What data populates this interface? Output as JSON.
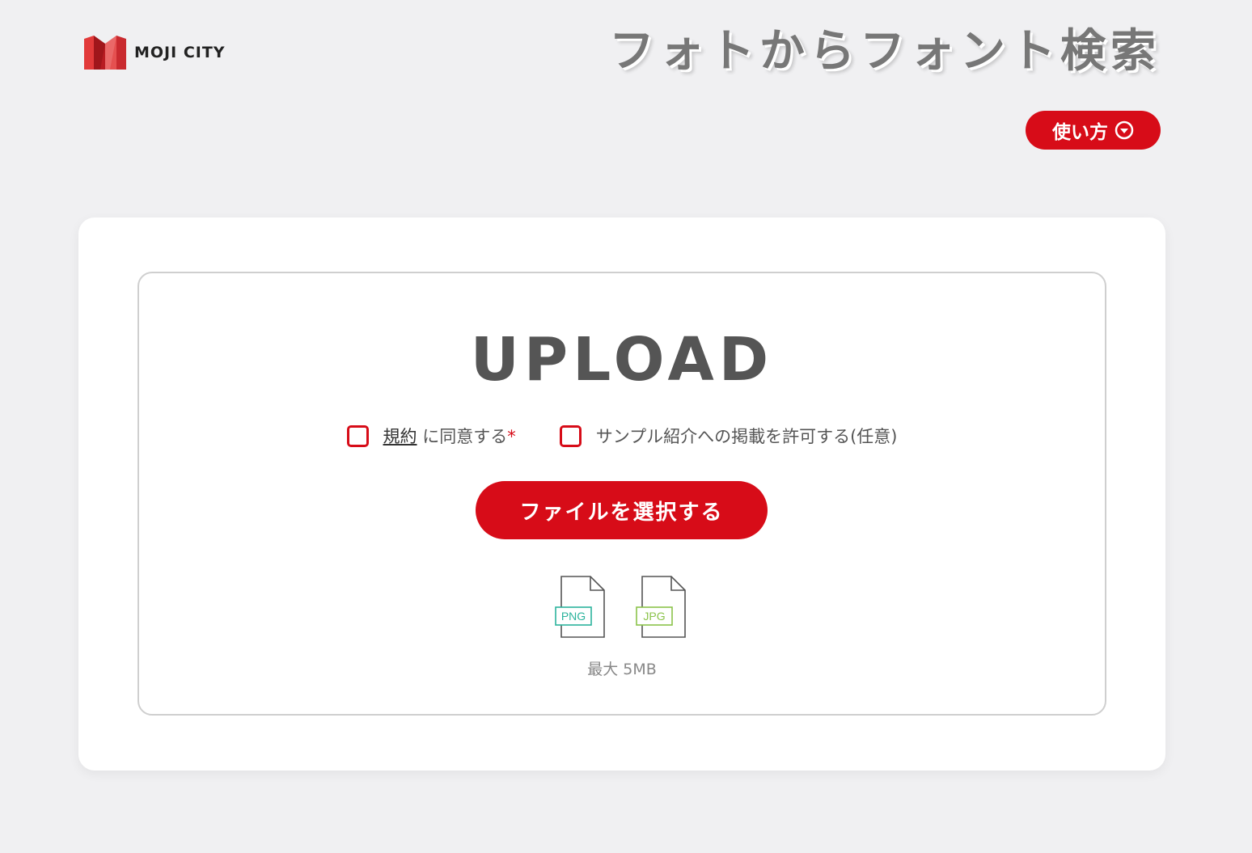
{
  "header": {
    "brand": "MOJI CITY",
    "site_title": "フォトからフォント検索",
    "howto_label": "使い方"
  },
  "upload": {
    "title": "UPLOAD",
    "terms_link": "規約",
    "terms_suffix": "に同意する",
    "required_mark": "*",
    "sample_consent": "サンプル紹介への掲載を許可する(任意)",
    "select_button": "ファイルを選択する",
    "file_types": [
      {
        "label": "PNG",
        "color": "#2bb39c"
      },
      {
        "label": "JPG",
        "color": "#8bc34a"
      }
    ],
    "max_size": "最大 5MB"
  },
  "colors": {
    "accent": "#d70c18",
    "background": "#f0f0f2",
    "card": "#ffffff"
  }
}
